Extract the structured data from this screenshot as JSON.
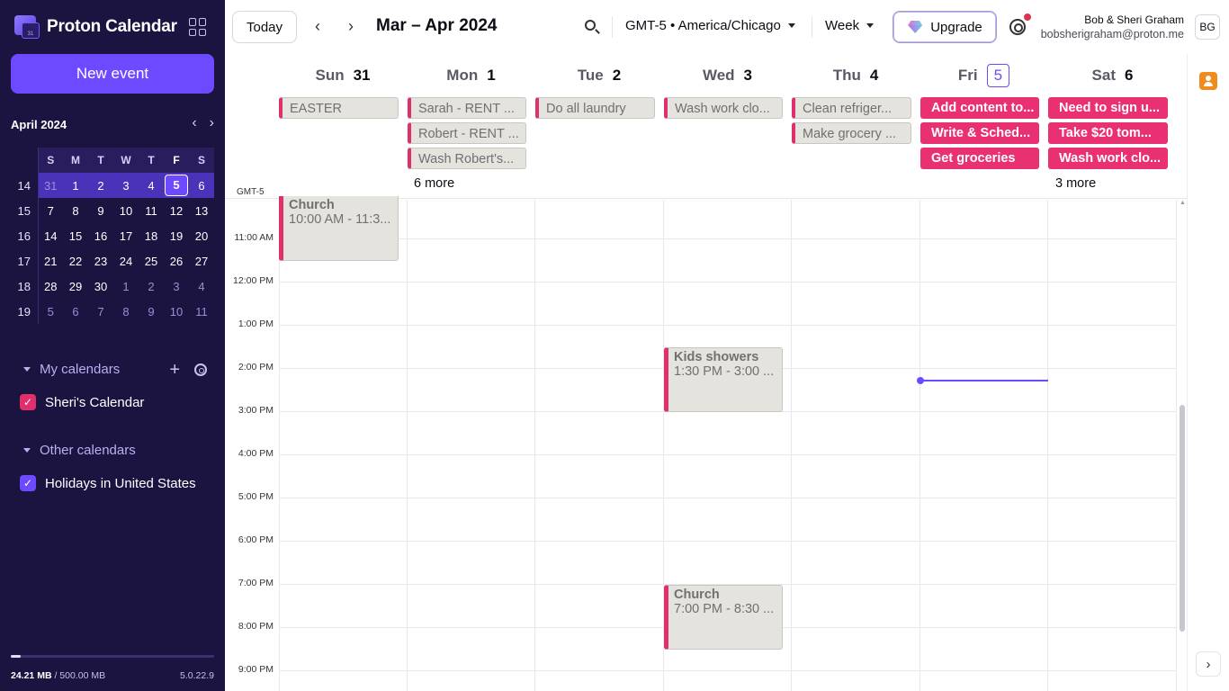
{
  "app": {
    "name": "Proton Calendar",
    "logo_badge": "31"
  },
  "sidebar": {
    "new_event_label": "New event",
    "mini_cal": {
      "title": "April 2024",
      "weekday_headers": [
        "S",
        "M",
        "T",
        "W",
        "T",
        "F",
        "S"
      ],
      "weeks": [
        {
          "num": "14",
          "days": [
            "31",
            "1",
            "2",
            "3",
            "4",
            "5",
            "6"
          ]
        },
        {
          "num": "15",
          "days": [
            "7",
            "8",
            "9",
            "10",
            "11",
            "12",
            "13"
          ]
        },
        {
          "num": "16",
          "days": [
            "14",
            "15",
            "16",
            "17",
            "18",
            "19",
            "20"
          ]
        },
        {
          "num": "17",
          "days": [
            "21",
            "22",
            "23",
            "24",
            "25",
            "26",
            "27"
          ]
        },
        {
          "num": "18",
          "days": [
            "28",
            "29",
            "30",
            "1",
            "2",
            "3",
            "4"
          ]
        },
        {
          "num": "19",
          "days": [
            "5",
            "6",
            "7",
            "8",
            "9",
            "10",
            "11"
          ]
        }
      ]
    },
    "my_calendars": {
      "label": "My calendars",
      "items": [
        {
          "name": "Sheri's Calendar",
          "color": "#e0306b"
        }
      ]
    },
    "other_calendars": {
      "label": "Other calendars",
      "items": [
        {
          "name": "Holidays in United States",
          "color": "#6d4aff"
        }
      ]
    },
    "storage": {
      "used": "24.21 MB",
      "total": "/ 500.00 MB",
      "fraction": 0.048
    },
    "version": "5.0.22.9"
  },
  "toolbar": {
    "today_label": "Today",
    "prev_icon": "chevron-left-icon",
    "next_icon": "chevron-right-icon",
    "range_title": "Mar – Apr 2024",
    "timezone": "GMT-5 • America/Chicago",
    "view": "Week",
    "upgrade_label": "Upgrade",
    "user_name": "Bob & Sheri Graham",
    "user_email": "bobsherigraham@proton.me",
    "avatar_initials": "BG"
  },
  "week": {
    "days": [
      {
        "name": "Sun",
        "num": "31"
      },
      {
        "name": "Mon",
        "num": "1"
      },
      {
        "name": "Tue",
        "num": "2"
      },
      {
        "name": "Wed",
        "num": "3"
      },
      {
        "name": "Thu",
        "num": "4"
      },
      {
        "name": "Fri",
        "num": "5",
        "current": true
      },
      {
        "name": "Sat",
        "num": "6"
      }
    ],
    "tz_label": "GMT-5",
    "all_day": {
      "sun": [
        "EASTER"
      ],
      "mon": [
        "Sarah - RENT ...",
        "Robert - RENT ...",
        "Wash Robert's..."
      ],
      "mon_more": "6 more",
      "tue": [
        "Do all laundry"
      ],
      "wed": [
        "Wash work clo..."
      ],
      "thu": [
        "Clean refriger...",
        "Make grocery ..."
      ],
      "fri": [
        "Add content to...",
        "Write & Sched...",
        "Get groceries"
      ],
      "sat": [
        "Need to sign u...",
        "Take $20 tom...",
        "Wash work clo..."
      ],
      "sat_more": "3 more"
    },
    "time_labels": [
      "11:00 AM",
      "12:00 PM",
      "1:00 PM",
      "2:00 PM",
      "3:00 PM",
      "4:00 PM",
      "5:00 PM",
      "6:00 PM",
      "7:00 PM",
      "8:00 PM",
      "9:00 PM"
    ],
    "timed_events": {
      "church_sun": {
        "title": "Church",
        "time": "10:00 AM - 11:3..."
      },
      "kids_showers": {
        "title": "Kids showers",
        "time": "1:30 PM - 3:00 ..."
      },
      "church_wed": {
        "title": "Church",
        "time": "7:00 PM - 8:30 ..."
      }
    }
  }
}
